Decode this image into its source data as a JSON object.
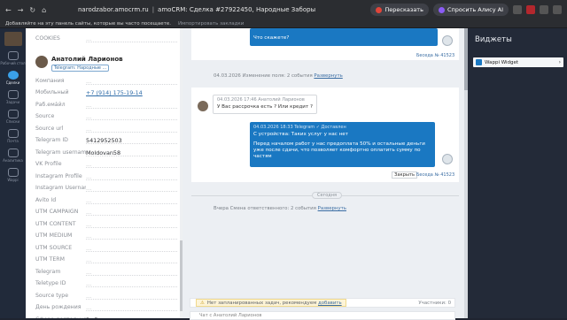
{
  "browser": {
    "url_host": "narodzabor.amocrm.ru",
    "tab_title": "amoCRM: Сделка #27922450, Народные Заборы",
    "retell_label": "Пересказать",
    "alice_label": "Спросить Алису AI",
    "bookmarks_prompt": "Добавляйте на эту панель сайты, которые вы часто посещаете.",
    "import_label": "Импортировать закладки"
  },
  "leftnav": [
    {
      "label": "Рабочий стол"
    },
    {
      "label": "Сделки"
    },
    {
      "label": "Задачи"
    },
    {
      "label": "Списки"
    },
    {
      "label": "Почта"
    },
    {
      "label": "Аналитика"
    },
    {
      "label": "Wappi"
    }
  ],
  "card": {
    "cookies_label": "COOKIES",
    "contact_name": "Анатолий Ларионов",
    "contact_tag": "Telegram: Народные ...",
    "fields": [
      {
        "label": "Компания",
        "value": "..."
      },
      {
        "label": "Мобильный",
        "value": "+7 (914) 175-19-14"
      },
      {
        "label": "Раб.ема́йл",
        "value": "..."
      },
      {
        "label": "Source",
        "value": "..."
      },
      {
        "label": "Source url",
        "value": "..."
      },
      {
        "label": "Telegram ID",
        "value": "5412952503"
      },
      {
        "label": "Telegram username",
        "value": "Moldovan58"
      },
      {
        "label": "VK Profile",
        "value": "..."
      },
      {
        "label": "Instagram Profile",
        "value": "..."
      },
      {
        "label": "Instagram Username",
        "value": "..."
      },
      {
        "label": "Avito Id",
        "value": "..."
      },
      {
        "label": "UTM CAMPAIGN",
        "value": "..."
      },
      {
        "label": "UTM CONTENT",
        "value": "..."
      },
      {
        "label": "UTM MEDIUM",
        "value": "..."
      },
      {
        "label": "UTM SOURCE",
        "value": "..."
      },
      {
        "label": "UTM TERM",
        "value": "..."
      },
      {
        "label": "Telegram",
        "value": "..."
      },
      {
        "label": "Teletype ID",
        "value": "..."
      },
      {
        "label": "Source type",
        "value": "..."
      },
      {
        "label": "День рождения",
        "value": "..."
      },
      {
        "label": "Сфера деятельности",
        "value": "Выбрать"
      }
    ]
  },
  "feed": {
    "msg1_text": "Что скажете?",
    "msg1_link": "Беседа № 41523",
    "note1_date": "04.03.2026",
    "note1_text": "Изменение поля: 2 события",
    "note1_link": "Развернуть",
    "msg2_meta": "04.03.2026 17:46 Анатолий Ларионов",
    "msg2_text": "У Вас рассрочка есть ? Или кредит ?",
    "msg3_meta": "04.03.2026 18:33 Telegram",
    "msg3_status": "Доставлен",
    "msg3_line1": "С устройства: Таких услуг у нас нет",
    "msg3_line2": "Перед началом работ у нас предоплата 50% и остальные деньги уже после сдачи, что позволяет комфортно оплатить сумму по частям",
    "close_label": "Закрыть",
    "msg3_link": "Беседа № 41523",
    "today_label": "Сегодня",
    "note2_text": "Вчера Смена ответственного: 2 события",
    "note2_link": "Развернуть",
    "warn_text": "Нет запланированных задач, рекомендуем",
    "warn_link": "добавить",
    "participants": "Участники: 0",
    "bottom_text": "Чат с Анатолий Ларионов"
  },
  "widgets": {
    "title": "Виджеты",
    "wappi_label": "Wappi Widget"
  },
  "colors": {
    "accent_blue": "#1a78c2",
    "sidebar_dark": "#212a3a",
    "widgets_dark": "#232a38"
  }
}
